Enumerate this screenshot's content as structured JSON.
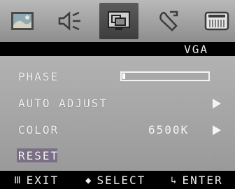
{
  "tabs": [
    {
      "icon": "picture-icon"
    },
    {
      "icon": "speaker-icon"
    },
    {
      "icon": "monitor-position-icon",
      "active": true
    },
    {
      "icon": "wrench-icon"
    },
    {
      "icon": "osd-settings-icon"
    }
  ],
  "source": {
    "label": "VGA"
  },
  "menu": {
    "phase": {
      "label": "PHASE",
      "level": 0.02
    },
    "auto_adjust": {
      "label": "AUTO ADJUST"
    },
    "color": {
      "label": "COLOR",
      "value": "6500K"
    },
    "reset": {
      "label": "RESET"
    }
  },
  "footer": {
    "exit": {
      "glyph": "Ⅲ",
      "label": "EXIT"
    },
    "select": {
      "glyph": "◆",
      "label": "SELECT"
    },
    "enter": {
      "glyph": "↳",
      "label": "ENTER"
    }
  },
  "colors": {
    "panel": "#a8a8a8",
    "highlight": "#7a6f86",
    "tabbar": "#a3a3a3"
  }
}
